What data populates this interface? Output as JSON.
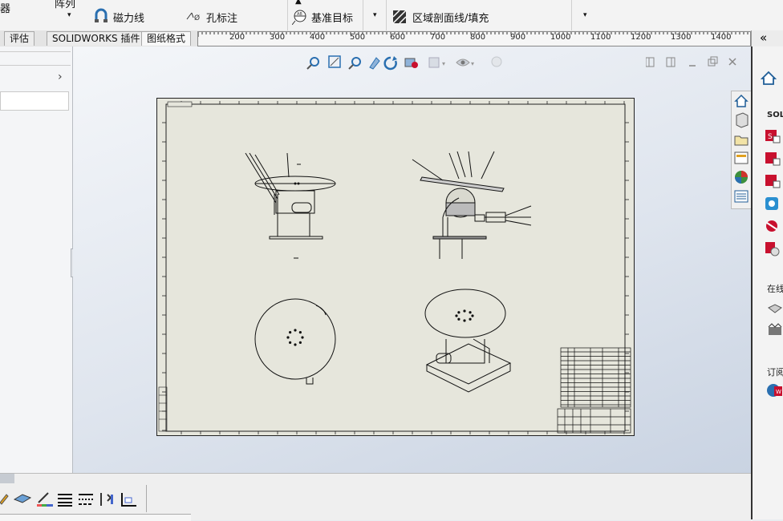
{
  "ribbon": {
    "label_zhuqi": "器",
    "label_lineararray": "阵列",
    "magnetic_line": "磁力线",
    "hole_callout": "孔标注",
    "datum_target": "基准目标",
    "area_hatch": "区域剖面线/填充"
  },
  "tabs": {
    "evaluate": "评估",
    "addins": "SOLIDWORKS 插件",
    "sheet_format": "图纸格式"
  },
  "ruler": {
    "ticks": [
      "200",
      "300",
      "400",
      "500",
      "600",
      "700",
      "800",
      "900",
      "1000",
      "1100",
      "1200",
      "1300",
      "1400"
    ],
    "collapse_glyph": "«"
  },
  "taskpane": {
    "solidworks_resources": "SOLI",
    "online": "在线",
    "subscription": "订阅"
  },
  "colors": {
    "sheet": "#e6e6dc",
    "accent_red": "#c8102e",
    "icon_blue": "#2a6fb0"
  },
  "icons": [
    "zoom-to-fit-icon",
    "zoom-to-area-icon",
    "previous-view-icon",
    "section-view-icon",
    "rotate-icon",
    "view-orientation-icon",
    "display-style-icon",
    "hide-show-icon",
    "appearance-icon",
    "home-icon",
    "3d-parts-icon",
    "folder-icon",
    "view-palette-icon",
    "appearances-icon",
    "custom-properties-icon"
  ]
}
